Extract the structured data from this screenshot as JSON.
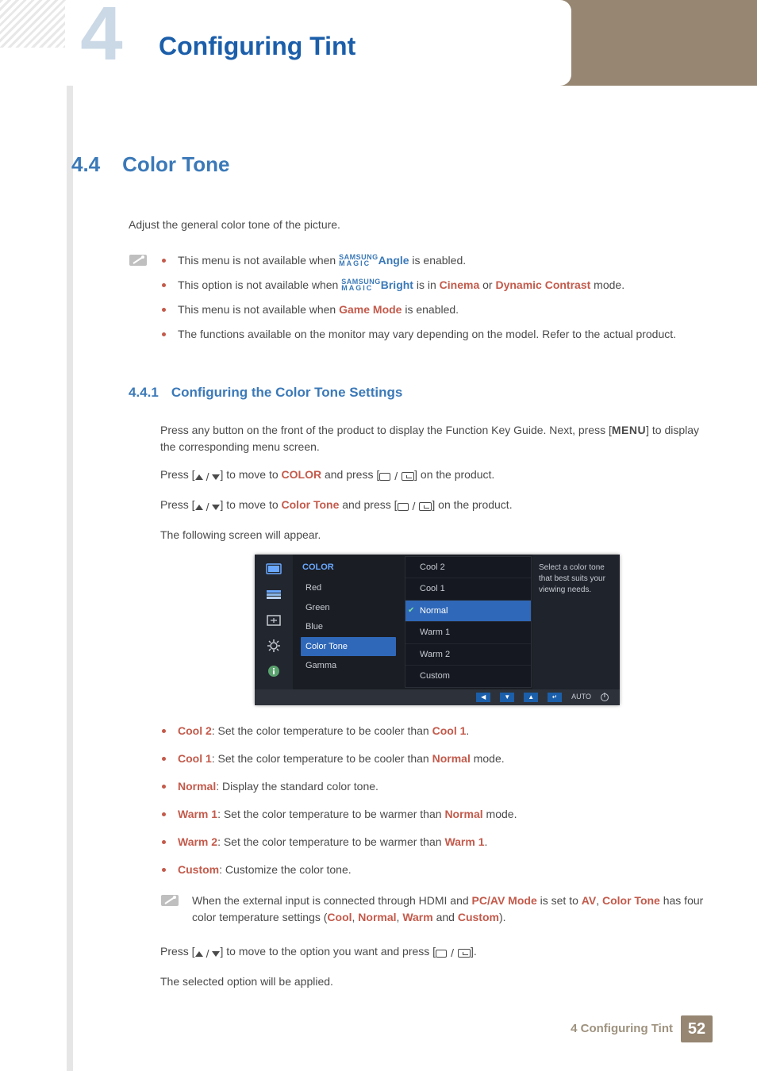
{
  "chapter": {
    "number": "4",
    "title": "Configuring Tint"
  },
  "section": {
    "number": "4.4",
    "title": "Color Tone"
  },
  "intro": "Adjust the general color tone of the picture.",
  "magic": {
    "brand": "SAMSUNG",
    "sub": "MAGIC"
  },
  "notes": {
    "n1a": "This menu is not available when ",
    "n1b": "Angle",
    "n1c": " is enabled.",
    "n2a": "This option is not available when ",
    "n2b": "Bright",
    "n2c": " is in ",
    "n2d": "Cinema",
    "n2e": " or ",
    "n2f": "Dynamic Contrast",
    "n2g": " mode.",
    "n3a": "This menu is not available when ",
    "n3b": "Game Mode",
    "n3c": " is enabled.",
    "n4": "The functions available on the monitor may vary depending on the model. Refer to the actual product."
  },
  "subsection": {
    "number": "4.4.1",
    "title": "Configuring the Color Tone Settings"
  },
  "steps": {
    "s1a": "Press any button on the front of the product to display the Function Key Guide. Next, press [",
    "s1b": "MENU",
    "s1c": "] to display the corresponding menu screen.",
    "s2a": "Press [",
    "s2b": "] to move to ",
    "s2c": "COLOR",
    "s2d": " and press [",
    "s2e": "] on the product.",
    "s3a": "Press [",
    "s3b": "] to move to ",
    "s3c": "Color Tone",
    "s3d": " and press [",
    "s3e": "] on the product.",
    "s4": "The following screen will appear."
  },
  "osd": {
    "menu_title": "COLOR",
    "items": [
      "Red",
      "Green",
      "Blue",
      "Color Tone",
      "Gamma"
    ],
    "options": [
      "Cool 2",
      "Cool 1",
      "Normal",
      "Warm 1",
      "Warm 2",
      "Custom"
    ],
    "selected_option_index": 2,
    "help": "Select a color tone that best suits your viewing needs.",
    "auto": "AUTO"
  },
  "options_desc": {
    "o1": {
      "k": "Cool 2",
      "a": ": Set the color temperature to be cooler than ",
      "b": "Cool 1",
      "c": "."
    },
    "o2": {
      "k": "Cool 1",
      "a": ": Set the color temperature to be cooler than ",
      "b": "Normal",
      "c": " mode."
    },
    "o3": {
      "k": "Normal",
      "a": ": Display the standard color tone."
    },
    "o4": {
      "k": "Warm 1",
      "a": ": Set the color temperature to be warmer than ",
      "b": "Normal",
      "c": " mode."
    },
    "o5": {
      "k": "Warm 2",
      "a": ": Set the color temperature to be warmer than ",
      "b": "Warm 1",
      "c": "."
    },
    "o6": {
      "k": "Custom",
      "a": ": Customize the color tone."
    }
  },
  "hdmi_note": {
    "a": "When the external input is connected through HDMI and ",
    "b": "PC/AV Mode",
    "c": " is set to ",
    "d": "AV",
    "e": ", ",
    "f": "Color Tone",
    "g": " has four color temperature settings (",
    "h1": "Cool",
    "h2": "Normal",
    "h3": "Warm",
    "h4": "Custom",
    "i": ", ",
    "j": " and ",
    "k": ")."
  },
  "final": {
    "f1a": "Press [",
    "f1b": "] to move to the option you want and press [",
    "f1c": "].",
    "f2": "The selected option will be applied."
  },
  "footer": {
    "text": "4 Configuring Tint",
    "page": "52"
  }
}
